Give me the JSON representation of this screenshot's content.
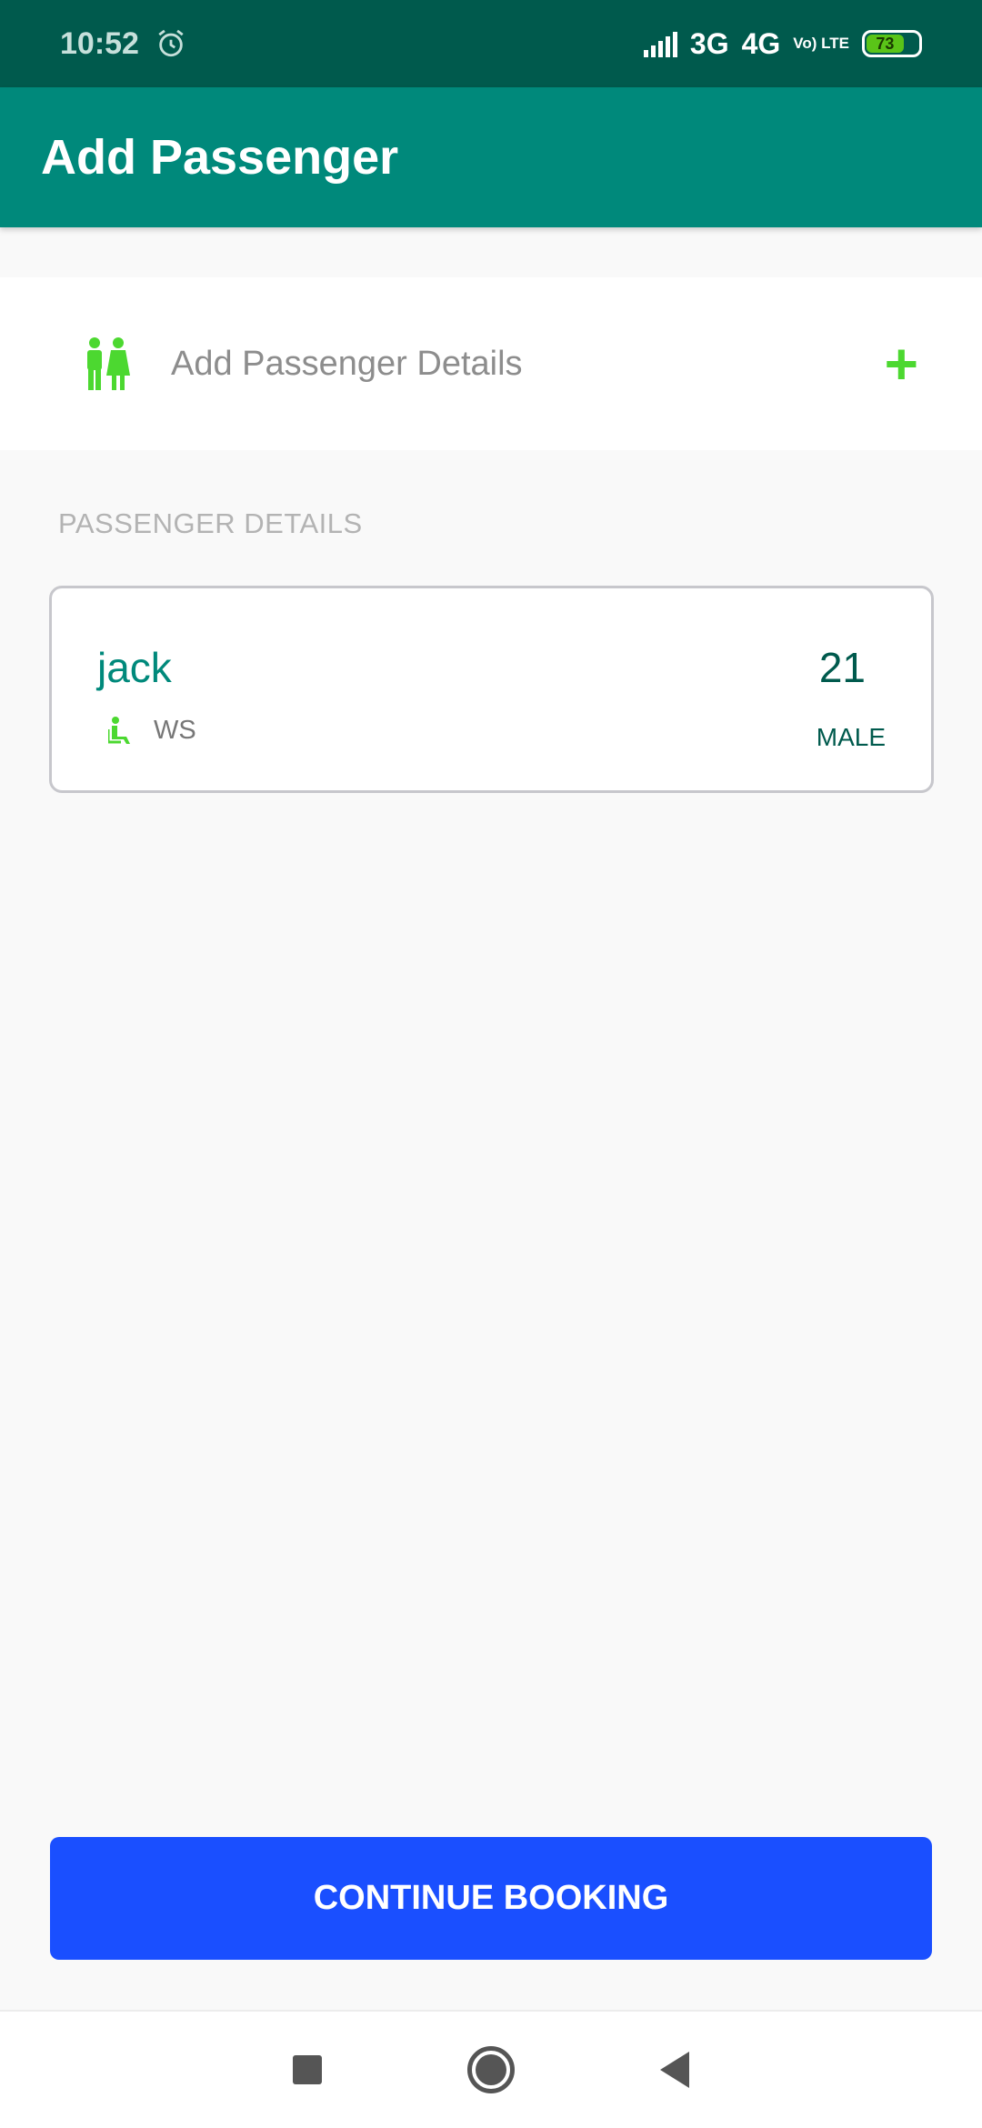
{
  "status_bar": {
    "time": "10:52",
    "network_3g": "3G",
    "network_4g": "4G",
    "volte": "Vo) LTE",
    "battery": "73",
    "battery_color": "#5ac418"
  },
  "app_bar": {
    "title": "Add Passenger",
    "color": "#00897b"
  },
  "add_card": {
    "label": "Add Passenger Details",
    "icon": "passengers-icon",
    "action_icon": "plus-icon",
    "accent": "#4cd830"
  },
  "section": {
    "header": "PASSENGER DETAILS"
  },
  "passengers": [
    {
      "name": "jack",
      "age": "21",
      "berth": "WS",
      "gender": "MALE",
      "berth_icon": "seat-icon"
    }
  ],
  "continue_button": {
    "label": "CONTINUE BOOKING",
    "color": "#1a4fff"
  },
  "nav_bar": {
    "icons": [
      "recents-icon",
      "home-icon",
      "back-icon"
    ]
  }
}
